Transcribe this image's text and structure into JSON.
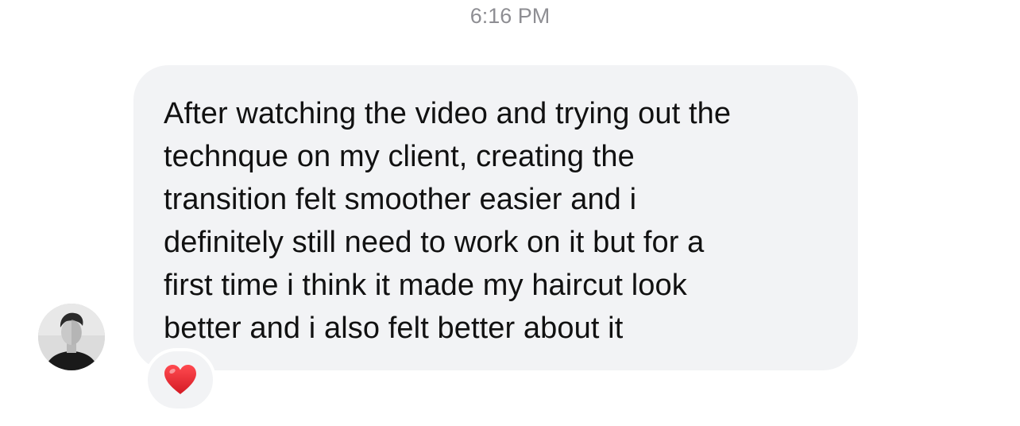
{
  "timestamp": "6:16 PM",
  "message": {
    "text": "After watching the video and trying out the\ntechnque on my client, creating the\ntransition felt smoother easier and i\ndefinitely still need to work on it but for a\nfirst time i think it made my haircut look\nbetter and i also felt better about it",
    "sender_avatar_icon": "profile-photo",
    "reaction": {
      "icon": "red-heart-icon",
      "color": "#e8262f"
    }
  },
  "colors": {
    "bubble": "#f2f3f5",
    "timestamp": "#8e8e93",
    "text": "#111111"
  }
}
